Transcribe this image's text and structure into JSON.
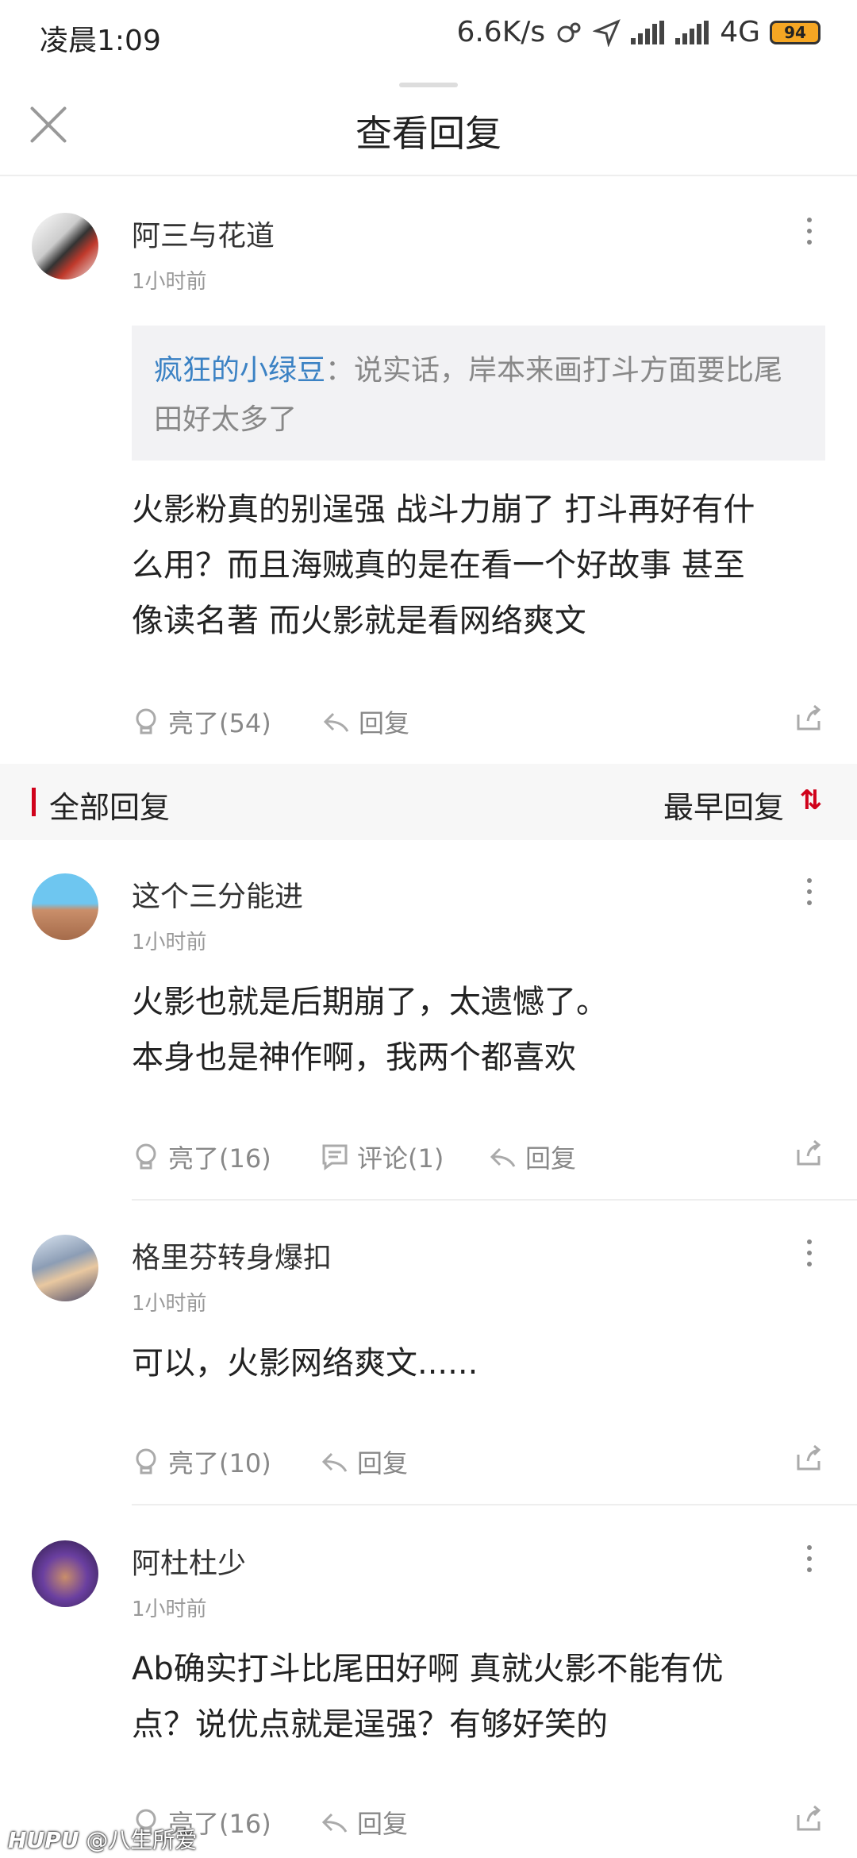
{
  "status_bar": {
    "time": "凌晨1:09",
    "speed": "6.6K/s",
    "network": "4G",
    "battery": "94"
  },
  "header": {
    "title": "查看回复"
  },
  "main_post": {
    "user": "阿三与花道",
    "time": "1小时前",
    "quote": {
      "name": "疯狂的小绿豆",
      "sep": "：",
      "text": "说实话，岸本来画打斗方面要比尾田好太多了"
    },
    "lines": [
      "火影粉真的别逞强 战斗力崩了 打斗再好有什",
      "么用？而且海贼真的是在看一个好故事 甚至",
      "像读名著 而火影就是看网络爽文"
    ],
    "likes": "亮了(54)",
    "reply": "回复"
  },
  "section": {
    "label": "全部回复",
    "sort": "最早回复"
  },
  "replies": [
    {
      "user": "这个三分能进",
      "time": "1小时前",
      "lines": [
        "火影也就是后期崩了，太遗憾了。",
        "本身也是神作啊，我两个都喜欢"
      ],
      "likes": "亮了(16)",
      "comments": "评论(1)",
      "reply": "回复"
    },
    {
      "user": "格里芬转身爆扣",
      "time": "1小时前",
      "lines": [
        "可以，火影网络爽文......"
      ],
      "likes": "亮了(10)",
      "reply": "回复"
    },
    {
      "user": "阿杜杜少",
      "time": "1小时前",
      "lines": [
        "Ab确实打斗比尾田好啊 真就火影不能有优",
        "点？说优点就是逞强？有够好笑的"
      ],
      "likes": "亮了(16)",
      "reply": "回复"
    }
  ],
  "watermark": {
    "brand": "HUPU",
    "handle": "@八生所爱"
  }
}
